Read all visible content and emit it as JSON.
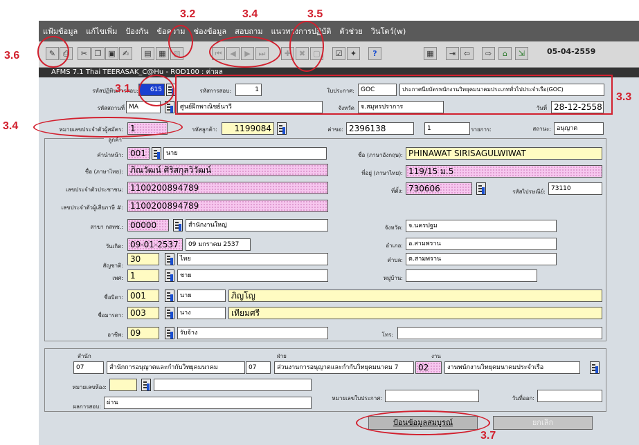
{
  "menu": [
    "แฟ้มข้อมูล",
    "แก้ไขเพิ่ม",
    "ป้องกัน",
    "ข้อความ",
    "ช่องข้อมูล",
    "สอบถาม",
    "แนวทางการปฏิบัติ",
    "ตัวช่วย",
    "วินโดว์(w)"
  ],
  "toolbar": {
    "date": "05-04-2559",
    "help": "?"
  },
  "window_title": "AFMS 7.1 Thai TEERASAK_C@Hu - ROD100 : ค่าผล",
  "header": {
    "exam_session_label": "รหัสปฏิทินการสอบ:",
    "exam_session_value": "615",
    "exam_code_label": "รหัสการสอบ:",
    "exam_code_value": "1",
    "license_label": "ใบประกาศ:",
    "license_code": "GOC",
    "license_desc": "ประกาศนียบัตรพนักงานวิทยุคมนาคมประเภททั่วไปประจำเรือ(GOC)",
    "venue_label": "รหัสสถานที่",
    "venue_code": "MA",
    "venue_name": "ศูนย์ฝึกพาณิชย์นาวี",
    "province_label": "จังหวัด",
    "province_value": "จ.สมุทรปราการ",
    "date_label": "วันที่",
    "date_value": "28-12-2558"
  },
  "row2": {
    "applicant_id_label": "หมายเลขประจำตัวผู้สมัคร:",
    "applicant_id_value": "1",
    "customer_code_label": "รหัสลูกค้า:",
    "customer_code_value": "1199084",
    "fee_label": "ค่าขอ:",
    "fee_value": "2396138",
    "item_label": "รายการ:",
    "item_value": "1",
    "status_label": "สถานะ:",
    "status_value": "อนุญาต"
  },
  "customer": {
    "group_label": "ลูกค้า",
    "prefix_label": "คำนำหน้า:",
    "prefix_code": "001",
    "prefix_name": "นาย",
    "name_th_label": "ชื่อ (ภาษาไทย):",
    "name_th": "ภิณวัฒน์ ศิริสกุลวิวัฒน์",
    "id_card_label": "เลขประจำตัวประชาชน:",
    "id_card": "1100200894789",
    "tax_id_label": "เลขประจำตัวผู้เสียภาษี #:",
    "tax_id": "1100200894789",
    "branch_label": "สาขา กสทช.:",
    "branch_code": "00000",
    "branch_name": "สำนักงานใหญ่",
    "dob_label": "วันเกิด:",
    "dob": "09-01-2537",
    "dob_text": "09 มกราคม 2537",
    "nationality_label": "สัญชาติ:",
    "nationality_code": "30",
    "nationality_name": "ไทย",
    "sex_label": "เพศ:",
    "sex_code": "1",
    "sex_name": "ชาย",
    "father_label": "ชื่อบิดา:",
    "father_code": "001",
    "father_prefix": "นาย",
    "father_name": "ภิญโญ",
    "mother_label": "ชื่อมารดา:",
    "mother_code": "003",
    "mother_prefix": "นาง",
    "mother_name": "เทียมศรี",
    "occupation_label": "อาชีพ:",
    "occupation_code": "09",
    "occupation_name": "รับจ้าง",
    "name_en_label": "ชื่อ (ภาษาอังกฤษ):",
    "name_en": "PHINAWAT SIRISAGULWIWAT",
    "address_label": "ที่อยู่ (ภาษาไทย):",
    "address": "119/15 ม.5",
    "location_label": "ที่ตั้ง:",
    "location_code": "730606",
    "postal_label": "รหัสไปรษณีย์:",
    "postal_code": "73110",
    "prov_label": "จังหวัด:",
    "prov_value": "จ.นครปฐม",
    "district_label": "อำเภอ:",
    "district_value": "อ.สามพราน",
    "subdistrict_label": "ตำบล:",
    "subdistrict_value": "ต.สามพราน",
    "village_label": "หมู่บ้าน:",
    "village_value": "",
    "phone_label": "โทร:",
    "phone_value": ""
  },
  "org": {
    "office_label": "สำนัก",
    "office_code": "07",
    "office_name": "สำนักการอนุญาตและกำกับวิทยุคมนาคม",
    "dept_label": "ฝ่าย",
    "dept_code": "07",
    "dept_name": "ส่วนงานการอนุญาตและกำกับวิทยุคมนาคม 7",
    "work_label": "งาน",
    "work_code": "02",
    "work_name": "งานพนักงานวิทยุคมนาคมประจำเรือ",
    "room_label": "หมายเลขห้อง:",
    "room_code": "",
    "room_name": "",
    "cert_no_label": "หมายเลขใบประกาศ:",
    "cert_no_value": "",
    "issue_date_label": "วันที่ออก:",
    "issue_date_value": "",
    "result_label": "ผลการสอบ:",
    "result_value": "ผ่าน"
  },
  "buttons": {
    "complete": "ป้อนข้อมูลสมบูรณ์",
    "cancel": "ยกเลิก"
  },
  "annotations": {
    "a3_1": "3.1",
    "a3_2": "3.2",
    "a3_3": "3.3",
    "a3_4_top": "3.4",
    "a3_4_left": "3.4",
    "a3_5": "3.5",
    "a3_6": "3.6",
    "a3_7": "3.7"
  }
}
